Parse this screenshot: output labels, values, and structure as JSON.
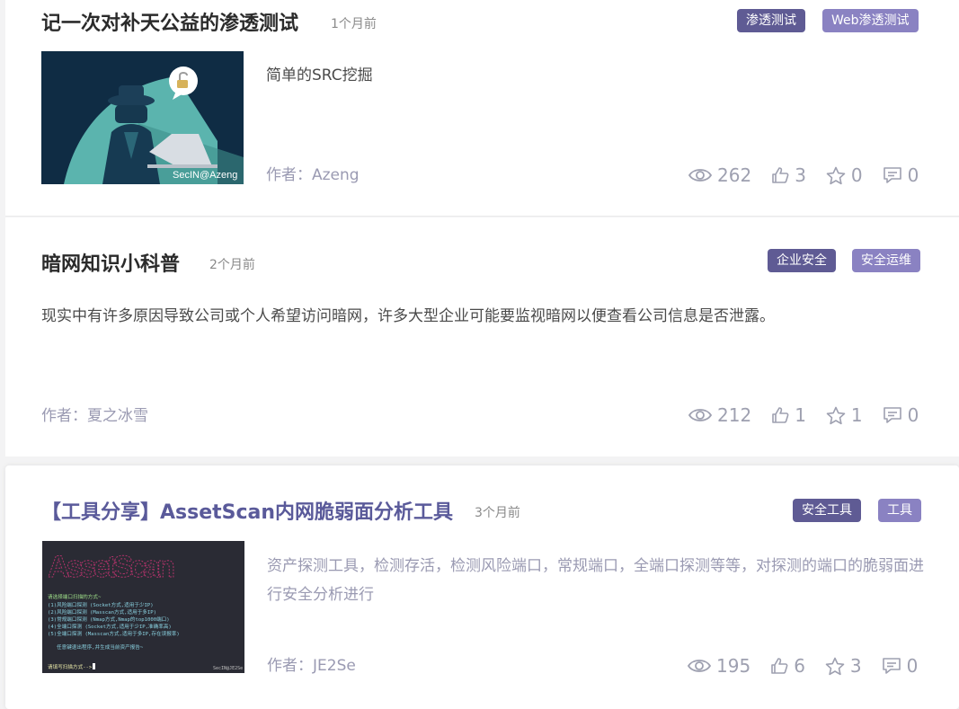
{
  "posts": [
    {
      "title": "记一次对补天公益的渗透测试",
      "time": "1个月前",
      "tags": [
        {
          "label": "渗透测试",
          "color": "#5f5b94"
        },
        {
          "label": "Web渗透测试",
          "color": "#8a82c2"
        }
      ],
      "description": "简单的SRC挖掘",
      "author": "作者：Azeng",
      "thumbnail": {
        "watermark": "SecIN@Azeng"
      },
      "stats": {
        "views": "262",
        "likes": "3",
        "favorites": "0",
        "comments": "0"
      }
    },
    {
      "title": "暗网知识小科普",
      "time": "2个月前",
      "tags": [
        {
          "label": "企业安全",
          "color": "#5f5b94"
        },
        {
          "label": "安全运维",
          "color": "#8a82c2"
        }
      ],
      "description": "现实中有许多原因导致公司或个人希望访问暗网，许多大型企业可能要监视暗网以便查看公司信息是否泄露。",
      "author": "作者：夏之冰雪",
      "stats": {
        "views": "212",
        "likes": "1",
        "favorites": "1",
        "comments": "0"
      }
    },
    {
      "title": "【工具分享】AssetScan内网脆弱面分析工具",
      "time": "3个月前",
      "tags": [
        {
          "label": "安全工具",
          "color": "#5f5b94"
        },
        {
          "label": "工具",
          "color": "#8a82c2"
        }
      ],
      "description": "资产探测工具，检测存活，检测风险端口，常规端口，全端口探测等等，对探测的端口的脆弱面进行安全分析进行",
      "author": "作者：JE2Se",
      "thumbnail": {
        "logo": "AssetScan",
        "menu_title": "请选择端口扫描的方式~",
        "menu_lines": [
          "(1)风险端口探测  (Socket方式,适用于少IP)",
          "(2)风险端口探测  (Masscan方式,适用于多IP)",
          "(3)常规端口探测  (Nmap方式,Nmap的top1000端口)",
          "(4)全端口探测    (Socket方式,适用于少IP,准确率高)",
          "(5)全端口探测    (Masscan方式,适用于多IP,存在误报率)"
        ],
        "hint": "任意键退出程序,并生成当前资产报告~",
        "prompt": "请填写扫描方式-->",
        "watermark": "SecIN@JE2Se"
      },
      "stats": {
        "views": "195",
        "likes": "6",
        "favorites": "3",
        "comments": "0"
      }
    }
  ]
}
